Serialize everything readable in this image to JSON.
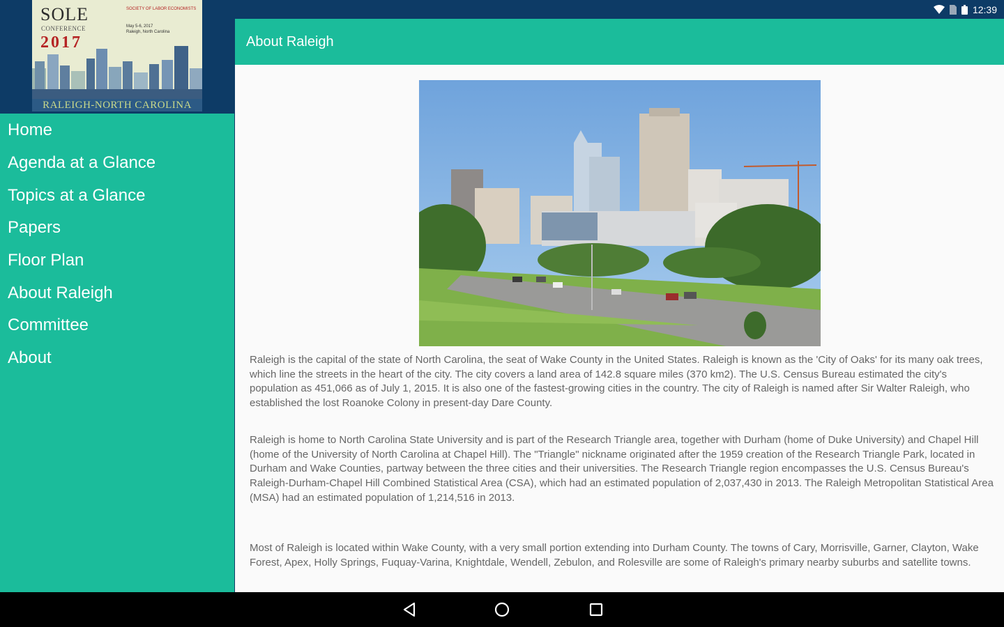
{
  "status_bar": {
    "time": "12:39",
    "icons": [
      "wifi-icon",
      "sim-icon",
      "battery-icon"
    ]
  },
  "logo": {
    "title": "SOLE",
    "subtitle": "CONFERENCE",
    "year": "2017",
    "organization": "SOCIETY OF LABOR ECONOMISTS",
    "dates": "May 5-6, 2017",
    "location": "Raleigh, North Carolina",
    "caption": "RALEIGH-NORTH CAROLINA"
  },
  "sidebar": {
    "items": [
      {
        "label": "Home"
      },
      {
        "label": "Agenda at a Glance"
      },
      {
        "label": "Topics at a Glance"
      },
      {
        "label": "Papers"
      },
      {
        "label": "Floor Plan"
      },
      {
        "label": "About Raleigh"
      },
      {
        "label": "Committee"
      },
      {
        "label": "About"
      }
    ]
  },
  "app_bar": {
    "title": "About Raleigh"
  },
  "content": {
    "paragraphs": [
      "Raleigh is the capital of the state of North Carolina, the seat of Wake County in the United States. Raleigh is known as the 'City of Oaks' for its many oak trees, which line the streets in the heart of the city. The city covers a land area of 142.8 square miles (370 km2). The U.S. Census Bureau estimated the city's population as 451,066 as of July 1, 2015. It is also one of the fastest-growing cities in the country. The city of Raleigh is named after Sir Walter Raleigh, who established the lost Roanoke Colony in present-day Dare County.",
      "Raleigh is home to North Carolina State University and is part of the Research Triangle area, together with Durham (home of Duke University) and Chapel Hill (home of the University of North Carolina at Chapel Hill). The \"Triangle\" nickname originated after the 1959 creation of the Research Triangle Park, located in Durham and Wake Counties, partway between the three cities and their universities. The Research Triangle region encompasses the U.S. Census Bureau's Raleigh-Durham-Chapel Hill Combined Statistical Area (CSA), which had an estimated population of 2,037,430 in 2013. The Raleigh Metropolitan Statistical Area (MSA) had an estimated population of 1,214,516 in 2013.",
      "Most of Raleigh is located within Wake County, with a very small portion extending into Durham County. The towns of Cary, Morrisville, Garner, Clayton, Wake Forest, Apex, Holly Springs, Fuquay-Varina, Knightdale, Wendell, Zebulon, and Rolesville are some of Raleigh's primary nearby suburbs and satellite towns."
    ]
  },
  "nav_bar": {
    "icons": [
      "back-icon",
      "home-icon",
      "recents-icon"
    ]
  },
  "colors": {
    "accent": "#1bbc9b",
    "status_bar": "#0d3b66",
    "content_background": "#fafafa",
    "body_text": "#666666"
  }
}
